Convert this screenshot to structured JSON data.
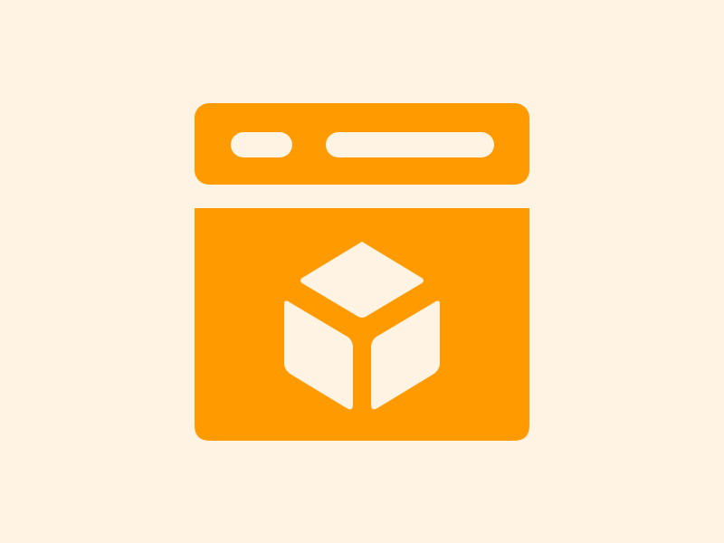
{
  "page": {
    "background": "#FFF3E3"
  },
  "icon": {
    "name": "browser-cube-icon",
    "accent": "#FF9A00",
    "cutout": "#FFF3E3"
  }
}
